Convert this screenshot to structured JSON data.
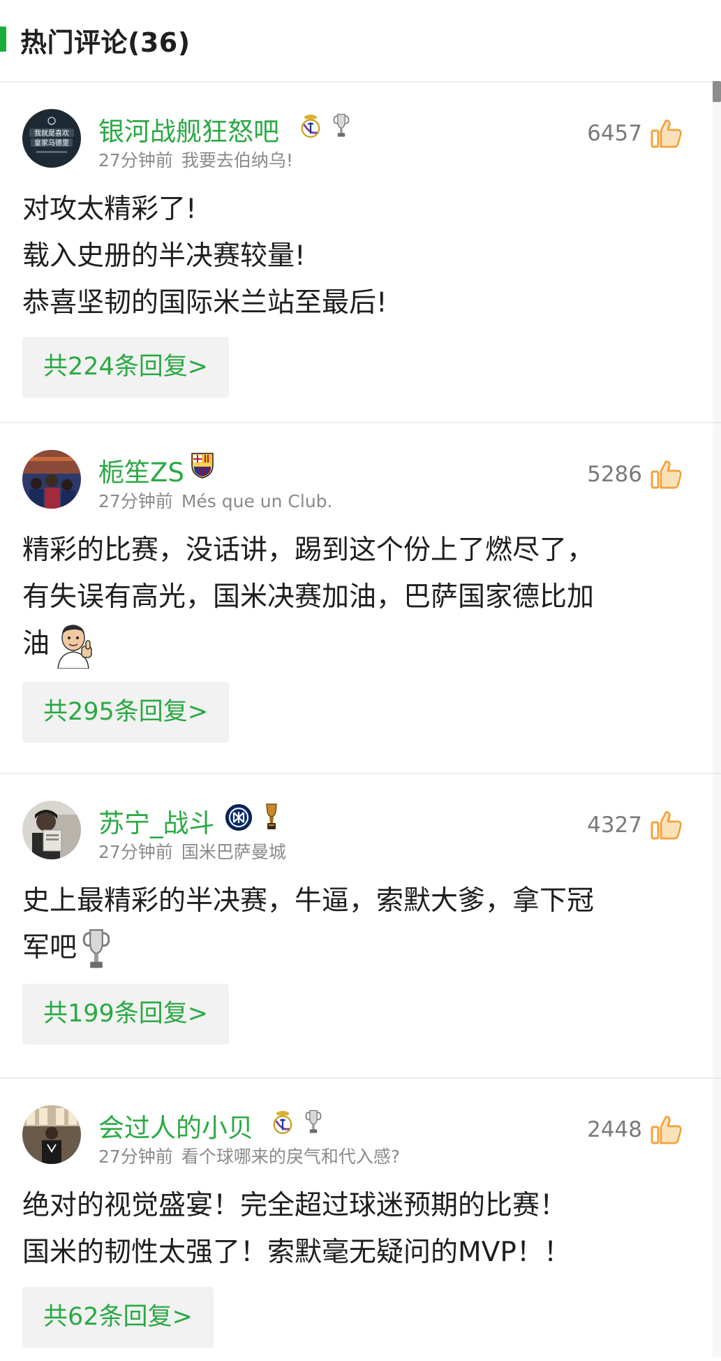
{
  "header": {
    "title": "热门评论(36)"
  },
  "comments": [
    {
      "username": "银河战舰狂怒吧",
      "time": "27分钟前",
      "signature": "我要去伯纳乌!",
      "likes": "6457",
      "lines": [
        "对攻太精彩了!",
        "载入史册的半决赛较量!",
        "恭喜坚韧的国际米兰站至最后!"
      ],
      "reply_label": "共224条回复>",
      "avatar_text": "我就是喜欢 皇家马德里",
      "badges": [
        "real-madrid-crest-icon",
        "champions-league-trophy-icon"
      ]
    },
    {
      "username": "栀笙ZS",
      "time": "27分钟前",
      "signature": "Més que un Club.",
      "likes": "5286",
      "lines": [
        "精彩的比赛，没话讲，踢到这个份上了燃尽了，",
        "有失误有高光，国米决赛加油，巴萨国家德比加",
        "油"
      ],
      "reply_label": "共295条回复>",
      "badges": [
        "fc-barcelona-crest-icon"
      ]
    },
    {
      "username": "苏宁_战斗",
      "time": "27分钟前",
      "signature": "国米巴萨曼城",
      "likes": "4327",
      "lines": [
        "史上最精彩的半决赛，牛逼，索默大爹，拿下冠",
        "军吧"
      ],
      "reply_label": "共199条回复>",
      "badges": [
        "inter-milan-crest-icon",
        "gold-trophy-icon"
      ]
    },
    {
      "username": "会过人的小贝",
      "time": "27分钟前",
      "signature": "看个球哪来的戾气和代入感?",
      "likes": "2448",
      "lines": [
        "绝对的视觉盛宴！完全超过球迷预期的比赛！",
        "国米的韧性太强了！索默毫无疑问的MVP！！"
      ],
      "reply_label": "共62条回复>",
      "badges": [
        "real-madrid-crest-icon",
        "champions-league-trophy-icon"
      ]
    }
  ],
  "colors": {
    "accent_green": "#2aa943",
    "header_bar": "#1aad3c",
    "like_orange": "#f5a23a",
    "meta_gray": "#8a8a8a"
  }
}
